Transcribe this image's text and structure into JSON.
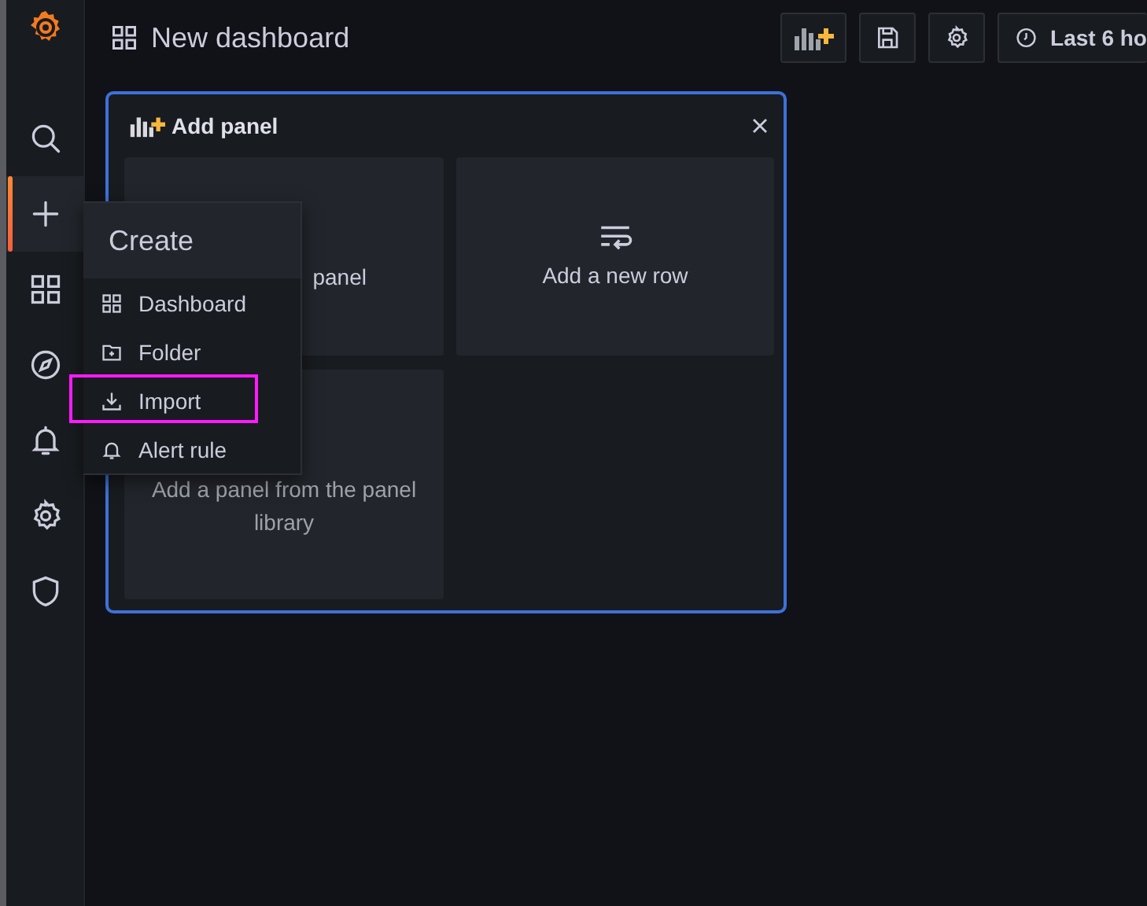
{
  "topbar": {
    "title": "New dashboard",
    "time_picker": "Last 6 ho"
  },
  "sidebar": {
    "items": [
      {
        "kind": "search",
        "selected": false
      },
      {
        "kind": "create",
        "selected": true
      },
      {
        "kind": "dashboards",
        "selected": false
      },
      {
        "kind": "explore",
        "selected": false
      },
      {
        "kind": "alerting",
        "selected": false
      },
      {
        "kind": "settings",
        "selected": false
      },
      {
        "kind": "shield",
        "selected": false
      }
    ]
  },
  "create_menu": {
    "title": "Create",
    "items": [
      {
        "kind": "dashboard",
        "label": "Dashboard",
        "highlighted": false
      },
      {
        "kind": "folder",
        "label": "Folder",
        "highlighted": false
      },
      {
        "kind": "import",
        "label": "Import",
        "highlighted": true
      },
      {
        "kind": "alert",
        "label": "Alert rule",
        "highlighted": false
      }
    ]
  },
  "add_panel": {
    "title": "Add panel",
    "cards": [
      {
        "kind": "panel",
        "label": "panel"
      },
      {
        "kind": "row",
        "label": "Add a new row"
      },
      {
        "kind": "library",
        "label": "Add a panel from the panel library"
      }
    ]
  }
}
